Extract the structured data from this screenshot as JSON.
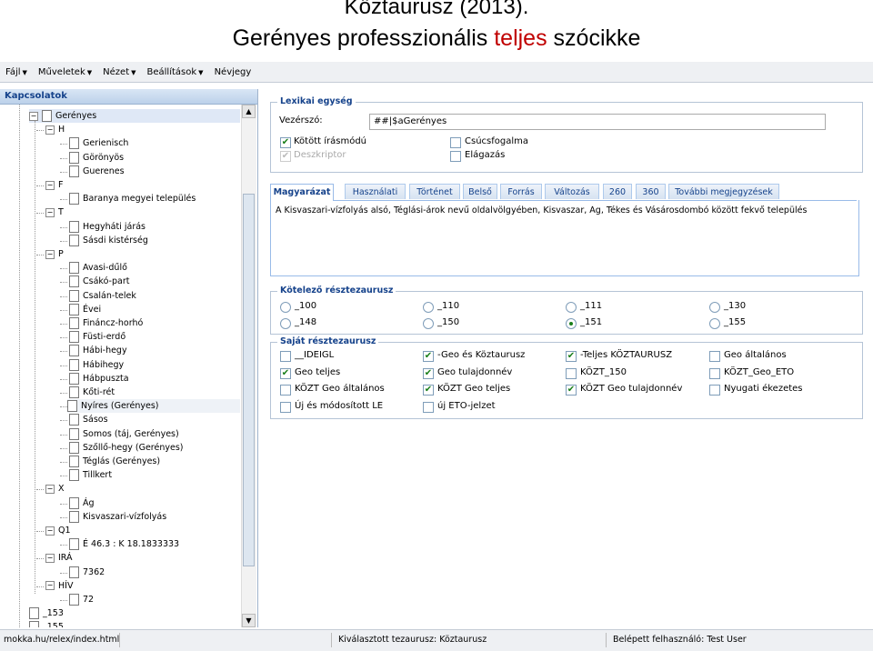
{
  "slide": {
    "title_line1": "Köztaurusz (2013).",
    "title_line2_pre": "Gerényes professzionális ",
    "title_line2_hl": "teljes",
    "title_line2_post": " szócikke"
  },
  "menubar": [
    "Fájl",
    "Műveletek",
    "Nézet",
    "Beállítások",
    "Névjegy"
  ],
  "sidebar": {
    "title": "Kapcsolatok",
    "tree": [
      {
        "label": "Gerényes",
        "level": 1,
        "type": "exp",
        "selected": true
      },
      {
        "label": "H",
        "level": 2,
        "type": "exp"
      },
      {
        "label": "Gerienisch",
        "level": 3,
        "type": "doc"
      },
      {
        "label": "Görönyös",
        "level": 3,
        "type": "doc"
      },
      {
        "label": "Guerenes",
        "level": 3,
        "type": "doc"
      },
      {
        "label": "F",
        "level": 2,
        "type": "exp"
      },
      {
        "label": "Baranya megyei település",
        "level": 3,
        "type": "doc"
      },
      {
        "label": "T",
        "level": 2,
        "type": "exp"
      },
      {
        "label": "Hegyháti járás",
        "level": 3,
        "type": "doc"
      },
      {
        "label": "Sásdi kistérség",
        "level": 3,
        "type": "doc"
      },
      {
        "label": "P",
        "level": 2,
        "type": "exp"
      },
      {
        "label": "Avasi-dűlő",
        "level": 3,
        "type": "doc"
      },
      {
        "label": "Csákó-part",
        "level": 3,
        "type": "doc"
      },
      {
        "label": "Csalán-telek",
        "level": 3,
        "type": "doc"
      },
      {
        "label": "Évei",
        "level": 3,
        "type": "doc"
      },
      {
        "label": "Fináncz-horhó",
        "level": 3,
        "type": "doc"
      },
      {
        "label": "Füsti-erdő",
        "level": 3,
        "type": "doc"
      },
      {
        "label": "Hábi-hegy",
        "level": 3,
        "type": "doc"
      },
      {
        "label": "Hábihegy",
        "level": 3,
        "type": "doc"
      },
      {
        "label": "Hábpuszta",
        "level": 3,
        "type": "doc"
      },
      {
        "label": "Kőti-rét",
        "level": 3,
        "type": "doc"
      },
      {
        "label": "Nyíres (Gerényes)",
        "level": 3,
        "type": "doc",
        "hover": true
      },
      {
        "label": "Sásos",
        "level": 3,
        "type": "doc"
      },
      {
        "label": "Somos (táj, Gerényes)",
        "level": 3,
        "type": "doc"
      },
      {
        "label": "Szőllő-hegy (Gerényes)",
        "level": 3,
        "type": "doc"
      },
      {
        "label": "Téglás (Gerényes)",
        "level": 3,
        "type": "doc"
      },
      {
        "label": "Tillkert",
        "level": 3,
        "type": "doc"
      },
      {
        "label": "X",
        "level": 2,
        "type": "exp"
      },
      {
        "label": "Ág",
        "level": 3,
        "type": "doc"
      },
      {
        "label": "Kisvaszari-vízfolyás",
        "level": 3,
        "type": "doc"
      },
      {
        "label": "Q1",
        "level": 2,
        "type": "exp"
      },
      {
        "label": "É 46.3 : K 18.1833333",
        "level": 3,
        "type": "doc"
      },
      {
        "label": "IRÁ",
        "level": 2,
        "type": "exp"
      },
      {
        "label": "7362",
        "level": 3,
        "type": "doc"
      },
      {
        "label": "HÍV",
        "level": 2,
        "type": "exp"
      },
      {
        "label": "72",
        "level": 3,
        "type": "doc"
      },
      {
        "label": "_153",
        "level": 0,
        "type": "doc"
      },
      {
        "label": "_155",
        "level": 0,
        "type": "doc"
      }
    ]
  },
  "lexical": {
    "legend": "Lexikai egység",
    "headword_label": "Vezérszó:",
    "headword_value": "##|$aGerényes",
    "checks": [
      {
        "label": "Kötött írásmódú",
        "checked": true,
        "disabled": false
      },
      {
        "label": "Csúcsfogalma",
        "checked": false,
        "disabled": false
      },
      {
        "label": "Deszkriptor",
        "checked": true,
        "disabled": true
      },
      {
        "label": "Elágazás",
        "checked": false,
        "disabled": false
      }
    ]
  },
  "tabs": [
    "Magyarázat",
    "Használati",
    "Történet",
    "Belső",
    "Forrás",
    "Változás",
    "260",
    "360",
    "További megjegyzések"
  ],
  "explanation_text": "A Kisvaszari-vízfolyás alsó, Téglási-árok nevű oldalvölgyében, Kisvaszar, Ág, Tékes és Vásárosdombó között fekvő település",
  "mandatory": {
    "legend": "Kötelező résztezaurusz",
    "options": [
      {
        "label": "_100",
        "selected": false
      },
      {
        "label": "_110",
        "selected": false
      },
      {
        "label": "_111",
        "selected": false
      },
      {
        "label": "_130",
        "selected": false
      },
      {
        "label": "_148",
        "selected": false
      },
      {
        "label": "_150",
        "selected": false
      },
      {
        "label": "_151",
        "selected": true
      },
      {
        "label": "_155",
        "selected": false
      }
    ]
  },
  "own": {
    "legend": "Saját résztezaurusz",
    "options": [
      {
        "label": "__IDEIGL",
        "checked": false
      },
      {
        "label": "-Geo és Köztaurusz",
        "checked": true
      },
      {
        "label": "-Teljes KÖZTAURUSZ",
        "checked": true
      },
      {
        "label": "Geo általános",
        "checked": false
      },
      {
        "label": "Geo teljes",
        "checked": true
      },
      {
        "label": "Geo tulajdonnév",
        "checked": true
      },
      {
        "label": "KÖZT_150",
        "checked": false
      },
      {
        "label": "KÖZT_Geo_ETO",
        "checked": false
      },
      {
        "label": "KÖZT Geo általános",
        "checked": false
      },
      {
        "label": "KÖZT Geo teljes",
        "checked": true
      },
      {
        "label": "KÖZT Geo tulajdonnév",
        "checked": true
      },
      {
        "label": "Nyugati ékezetes",
        "checked": false
      },
      {
        "label": "Új és módosított LE",
        "checked": false
      },
      {
        "label": "új ETO-jelzet",
        "checked": false
      }
    ]
  },
  "footer": {
    "url": "mokka.hu/relex/index.html",
    "thesaurus": "Kiválasztott tezaurusz: Köztaurusz",
    "user": "Belépett felhasználó: Test User"
  }
}
